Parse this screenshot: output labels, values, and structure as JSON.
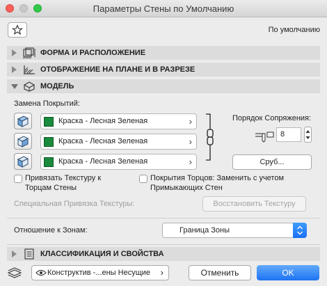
{
  "window": {
    "title": "Параметры Стены по Умолчанию"
  },
  "header": {
    "favorites_icon": "star-icon",
    "default_label": "По умолчанию"
  },
  "sections": {
    "shape": {
      "label": "ФОРМА И РАСПОЛОЖЕНИЕ",
      "expanded": false
    },
    "plan": {
      "label": "ОТОБРАЖЕНИЕ НА ПЛАНЕ И В РАЗРЕЗЕ",
      "expanded": false
    },
    "model": {
      "label": "МОДЕЛЬ",
      "expanded": true
    },
    "classification": {
      "label": "КЛАССИФИКАЦИЯ И СВОЙСТВА",
      "expanded": false
    }
  },
  "model": {
    "surface_override_label": "Замена Покрытий:",
    "surfaces": [
      {
        "name": "Краска - Лесная Зеленая",
        "color": "#1a8a3c"
      },
      {
        "name": "Краска - Лесная Зеленая",
        "color": "#1a8a3c"
      },
      {
        "name": "Краска - Лесная Зеленая",
        "color": "#1a8a3c"
      }
    ],
    "priority_label": "Порядок Сопряжения:",
    "priority_value": "8",
    "priority_button": "Сруб...",
    "checkbox_align_texture": "Привязать Текстуру к Торцам Стены",
    "checkbox_end_surfaces": "Покрытия Торцов: Заменить с учетом Примыкающих Стен",
    "special_align_label": "Специальная Привязка Текстуры:",
    "restore_texture_button": "Восстановить Текстуру",
    "zone_relation_label": "Отношение к Зонам:",
    "zone_relation_value": "Граница Зоны"
  },
  "footer": {
    "layer_value": "Конструктив -...ены Несущие",
    "cancel_label": "Отменить",
    "ok_label": "OK"
  },
  "colors": {
    "accent": "#1d73f3",
    "surface_swatch": "#1a8a3c"
  }
}
